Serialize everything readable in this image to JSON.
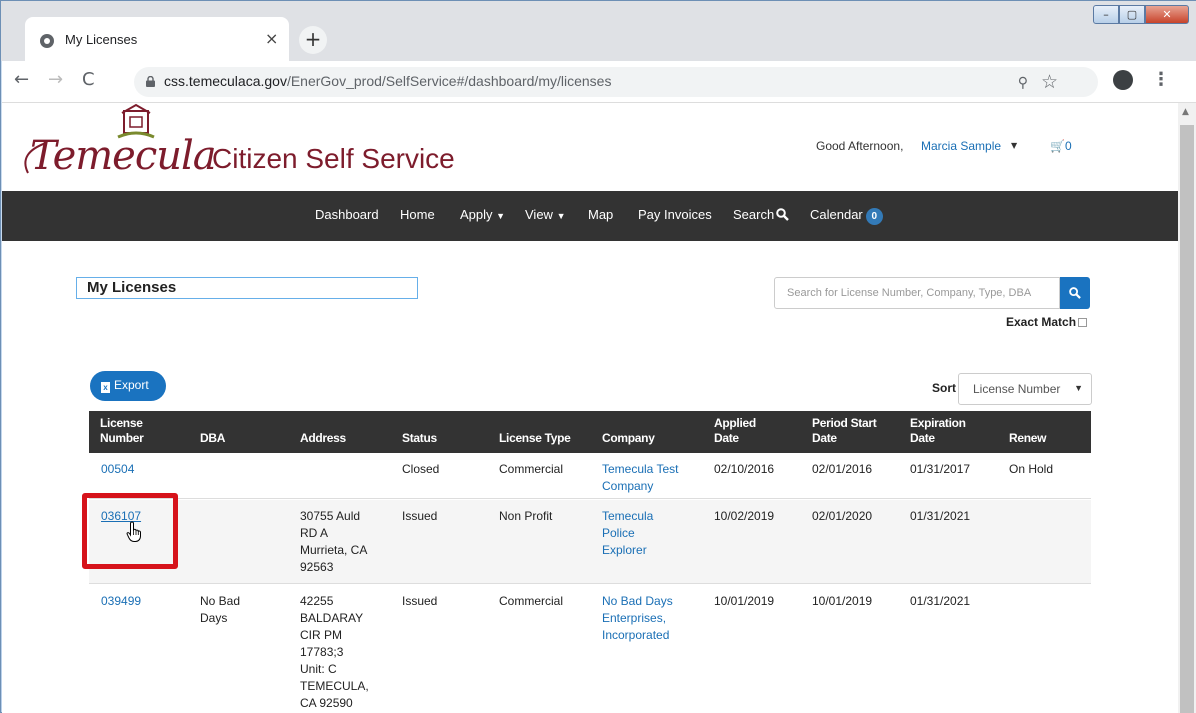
{
  "browser": {
    "tab_title": "My Licenses",
    "tab_close": "×",
    "new_tab": "+",
    "url_host": "css.temeculaca.gov",
    "url_path": "/EnerGov_prod/SelfService#/dashboard/my/licenses",
    "window_controls": [
      "minimize",
      "maximize",
      "close"
    ]
  },
  "header": {
    "logo_text": "Temecula",
    "site_title": "Citizen Self Service",
    "greeting": "Good Afternoon,",
    "user_name": "Marcia Sample",
    "cart_count": "0"
  },
  "nav": {
    "items": [
      "Dashboard",
      "Home",
      "Apply",
      "View",
      "Map",
      "Pay Invoices",
      "Search",
      "Calendar"
    ],
    "calendar_badge": "0"
  },
  "page": {
    "heading": "My Licenses",
    "search_placeholder": "Search for License Number, Company, Type, DBA",
    "exact_match": "Exact Match",
    "export_label": "Export",
    "sort_label": "Sort",
    "sort_value": "License Number"
  },
  "table": {
    "headers": [
      [
        "License",
        "Number"
      ],
      [
        "",
        "DBA"
      ],
      [
        "",
        "Address"
      ],
      [
        "",
        "Status"
      ],
      [
        "",
        "License Type"
      ],
      [
        "",
        "Company"
      ],
      [
        "Applied",
        "Date"
      ],
      [
        "Period Start",
        "Date"
      ],
      [
        "Expiration",
        "Date"
      ],
      [
        "",
        "Renew"
      ]
    ],
    "rows": [
      {
        "license": "00504",
        "dba": [],
        "address": [],
        "status": "Closed",
        "type": "Commercial",
        "company": [
          "Temecula Test",
          "Company"
        ],
        "applied": "02/10/2016",
        "period_start": "02/01/2016",
        "expiration": "01/31/2017",
        "renew": "On Hold"
      },
      {
        "license": "036107",
        "dba": [],
        "address": [
          "30755 Auld",
          "RD A",
          "Murrieta, CA",
          "92563"
        ],
        "status": "Issued",
        "type": "Non Profit",
        "company": [
          "Temecula",
          "Police",
          "Explorer"
        ],
        "applied": "10/02/2019",
        "period_start": "02/01/2020",
        "expiration": "01/31/2021",
        "renew": ""
      },
      {
        "license": "039499",
        "dba": [
          "No Bad",
          "Days"
        ],
        "address": [
          "42255",
          "BALDARAY",
          "CIR PM",
          "17783;3",
          "Unit: C",
          "TEMECULA,",
          "CA 92590"
        ],
        "status": "Issued",
        "type": "Commercial",
        "company": [
          "No Bad Days",
          "Enterprises,",
          "Incorporated"
        ],
        "applied": "10/01/2019",
        "period_start": "10/01/2019",
        "expiration": "01/31/2021",
        "renew": ""
      }
    ]
  },
  "colors": {
    "brand_maroon": "#7d1c2c",
    "nav_dark": "#333333",
    "link_blue": "#1a6fb5",
    "button_blue": "#1a73c0",
    "highlight_red": "#d6131b"
  }
}
